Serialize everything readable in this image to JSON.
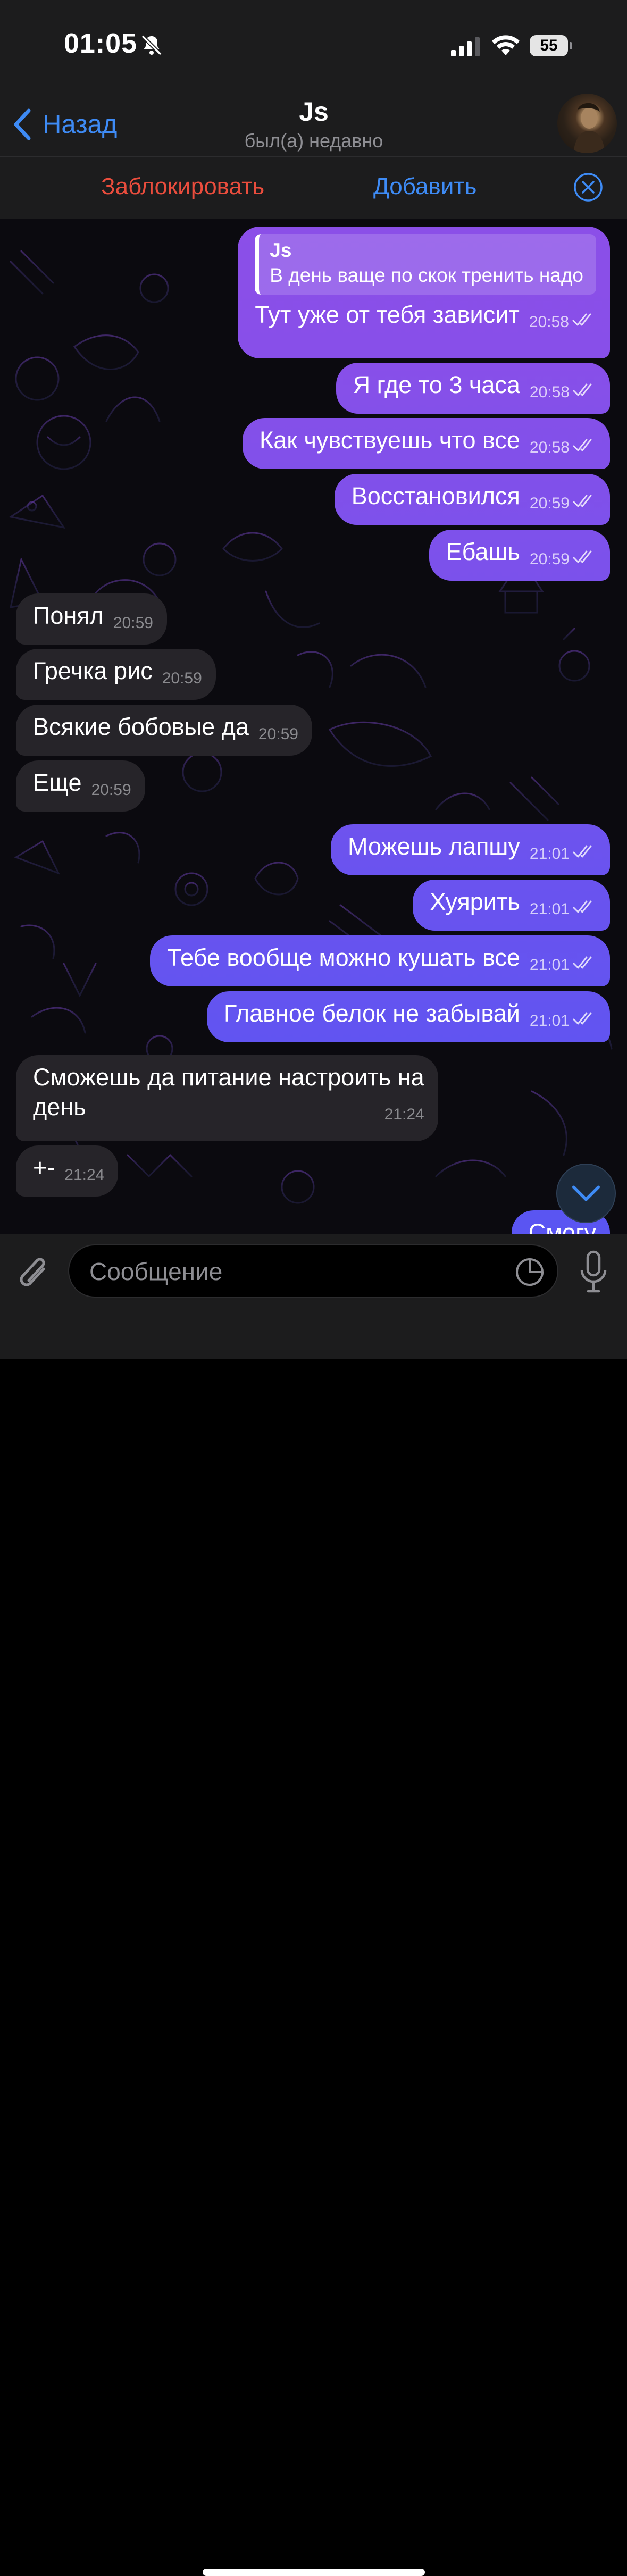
{
  "status_bar": {
    "time": "01:05",
    "battery": "55",
    "icons": [
      "bell-slash-icon",
      "signal-icon",
      "wifi-icon",
      "battery-icon"
    ]
  },
  "header": {
    "back_label": "Назад",
    "title": "Js",
    "subtitle": "был(а) недавно",
    "avatar_icon": "contact-avatar"
  },
  "action_bar": {
    "block_label": "Заблокировать",
    "add_label": "Добавить",
    "close_icon": "close-circle-icon"
  },
  "colors": {
    "accent_blue": "#3e8bf5",
    "block_red": "#ea4d3d",
    "bubble_out_top": "#8b4fe8",
    "bubble_out_bottom": "#5a55f2",
    "bubble_in": "#262429"
  },
  "messages": [
    {
      "dir": "out",
      "reply_to": {
        "name": "Js",
        "text": "В день ваще по скок тренить надо"
      },
      "text": "Тут уже от тебя зависит",
      "time": "20:58",
      "read": true
    },
    {
      "dir": "out",
      "text": "Я где то 3 часа",
      "time": "20:58",
      "read": true
    },
    {
      "dir": "out",
      "text": "Как чувствуешь что все",
      "time": "20:58",
      "read": true
    },
    {
      "dir": "out",
      "text": "Восстановился",
      "time": "20:59",
      "read": true
    },
    {
      "dir": "out",
      "text": "Ебашь",
      "time": "20:59",
      "read": true
    },
    {
      "dir": "in",
      "text": "Понял",
      "time": "20:59"
    },
    {
      "dir": "in",
      "text": "Гречка рис",
      "time": "20:59"
    },
    {
      "dir": "in",
      "text": "Всякие бобовые да",
      "time": "20:59"
    },
    {
      "dir": "in",
      "text": "Еще",
      "time": "20:59"
    },
    {
      "dir": "out",
      "text": "Можешь лапшу",
      "time": "21:01",
      "read": true
    },
    {
      "dir": "out",
      "text": "Хуярить",
      "time": "21:01",
      "read": true
    },
    {
      "dir": "out",
      "text": "Тебе вообще можно кушать все",
      "time": "21:01",
      "read": true
    },
    {
      "dir": "out",
      "text": "Главное белок не забывай",
      "time": "21:01",
      "read": true
    },
    {
      "dir": "in",
      "text_line1": "Сможешь да питание настроить на",
      "text_line2": "день",
      "time": "21:24"
    },
    {
      "dir": "in",
      "text": "+-",
      "time": "21:24"
    },
    {
      "dir": "out",
      "text": "Смогу",
      "partial": true
    }
  ],
  "input_bar": {
    "placeholder": "Сообщение",
    "icons": [
      "paperclip-icon",
      "sticker-icon",
      "microphone-icon"
    ]
  },
  "scroll_button_icon": "chevron-down-icon"
}
